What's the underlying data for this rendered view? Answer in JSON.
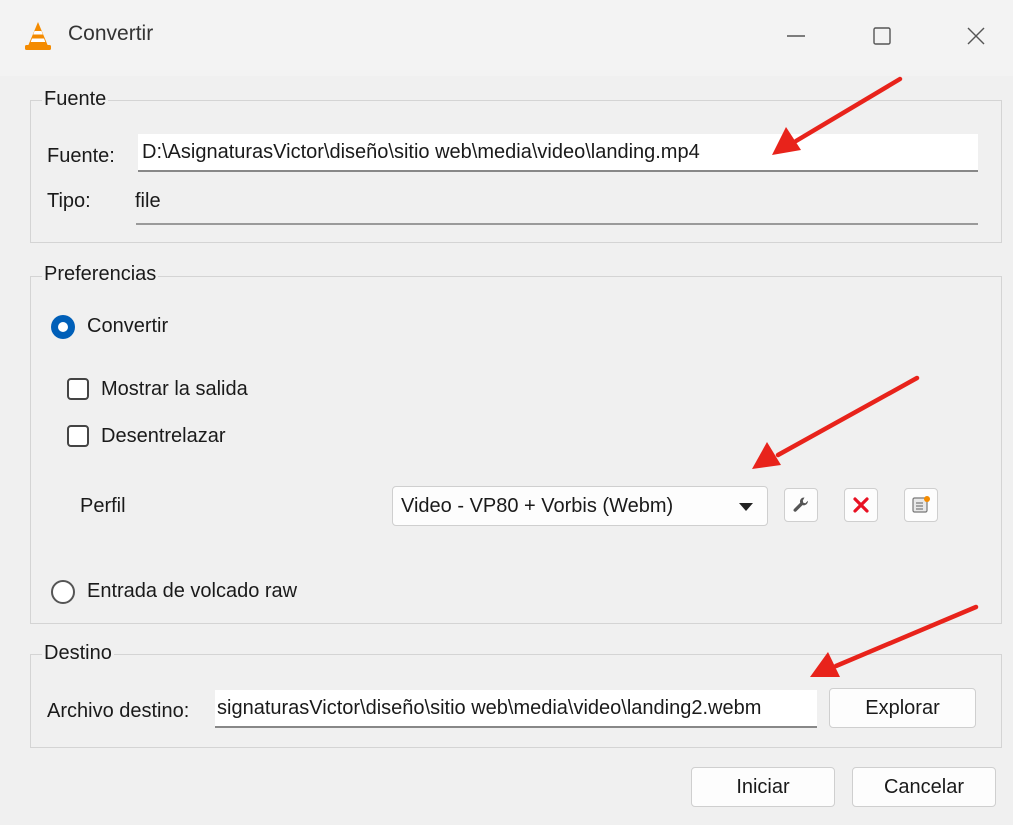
{
  "window": {
    "title": "Convertir",
    "app_icon": "vlc-cone-icon",
    "controls": [
      "minimize-icon",
      "maximize-icon",
      "close-icon"
    ]
  },
  "source_group": {
    "legend": "Fuente",
    "source_label": "Fuente:",
    "source_value": "D:\\AsignaturasVictor\\diseño\\sitio web\\media\\video\\landing.mp4",
    "type_label": "Tipo:",
    "type_value": "file"
  },
  "preferences_group": {
    "legend": "Preferencias",
    "convert_radio_label": "Convertir",
    "convert_selected": true,
    "show_output_label": "Mostrar la salida",
    "show_output_checked": false,
    "deinterlace_label": "Desentrelazar",
    "deinterlace_checked": false,
    "profile_label": "Perfil",
    "profile_value": "Video - VP80 + Vorbis (Webm)",
    "profile_buttons": [
      "wrench-icon",
      "delete-x-icon",
      "new-profile-icon"
    ],
    "raw_dump_label": "Entrada de volcado raw",
    "raw_dump_selected": false
  },
  "destination_group": {
    "legend": "Destino",
    "file_label": "Archivo destino:",
    "file_value": "signaturasVictor\\diseño\\sitio web\\media\\video\\landing2.webm",
    "browse_label": "Explorar"
  },
  "footer": {
    "start_label": "Iniciar",
    "cancel_label": "Cancelar"
  },
  "colors": {
    "accent": "#005fb8",
    "delete_red": "#e81123",
    "annotation_arrow": "#e8231b"
  }
}
